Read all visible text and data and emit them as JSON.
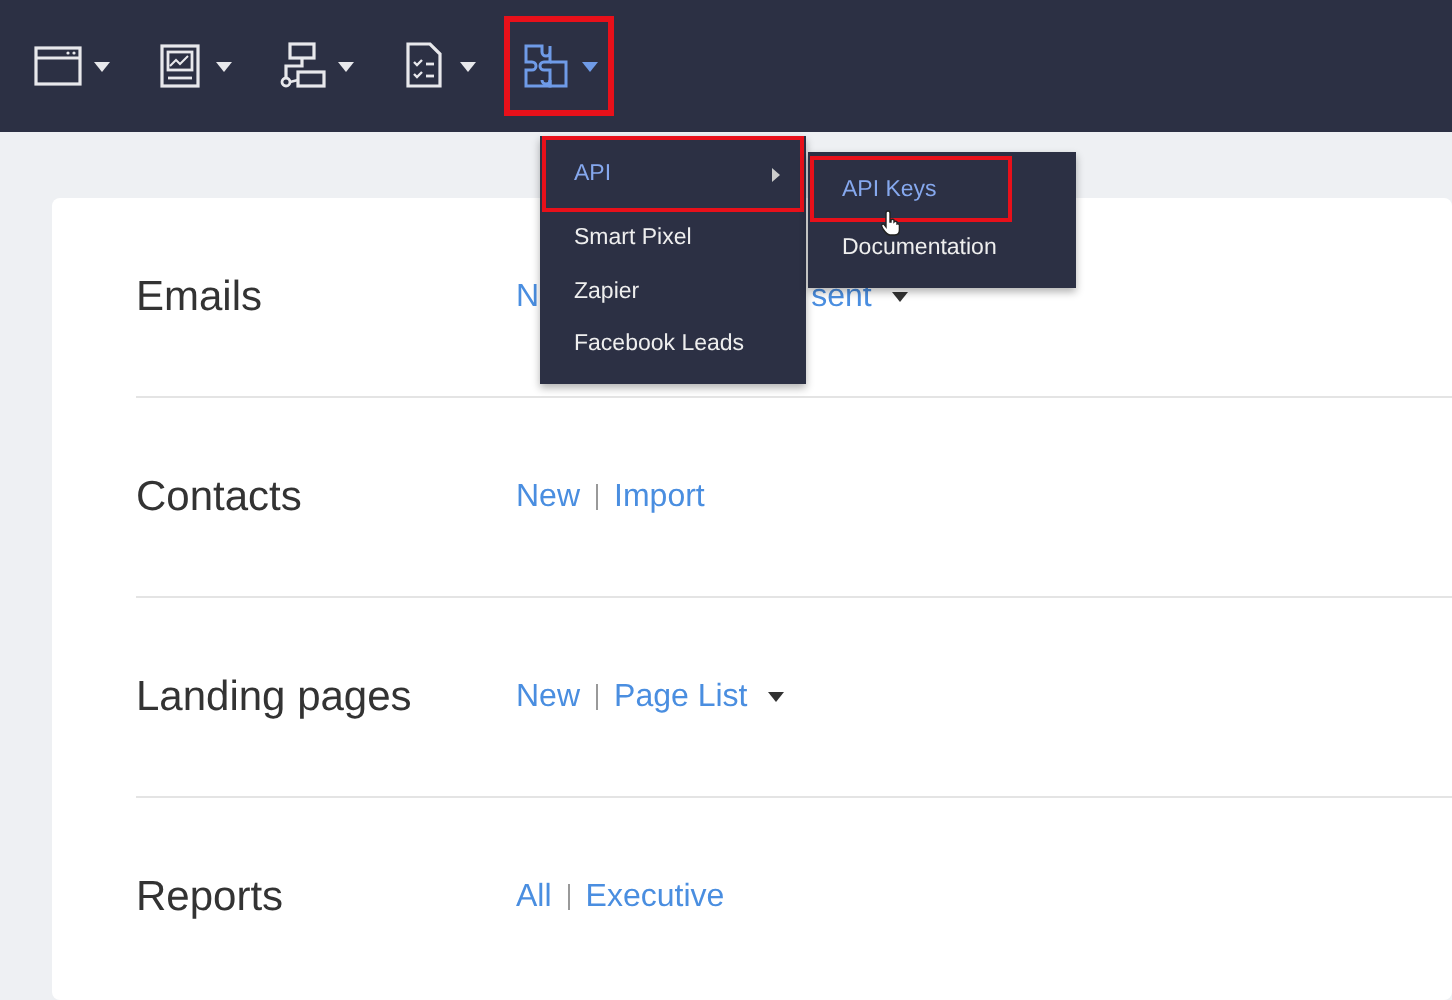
{
  "toolbar": [
    {
      "selected": false
    },
    {
      "selected": false
    },
    {
      "selected": false
    },
    {
      "selected": false
    },
    {
      "selected": true
    }
  ],
  "rows": [
    {
      "title": "Emails",
      "kind": "partial",
      "links": [
        "N",
        "sent"
      ],
      "dropdown": true
    },
    {
      "title": "Contacts",
      "kind": "full",
      "links": [
        "New",
        "Import"
      ],
      "dropdown": false
    },
    {
      "title": "Landing pages",
      "kind": "full",
      "links": [
        "New",
        "Page List"
      ],
      "dropdown": true
    },
    {
      "title": "Reports",
      "kind": "full",
      "links": [
        "All",
        "Executive"
      ],
      "dropdown": false
    }
  ],
  "menu": {
    "items": [
      {
        "label": "API",
        "highlighted": true,
        "submenu": true
      },
      {
        "label": "Smart Pixel",
        "highlighted": false,
        "submenu": false
      },
      {
        "label": "Zapier",
        "highlighted": false,
        "submenu": false
      },
      {
        "label": "Facebook Leads",
        "highlighted": false,
        "submenu": false
      }
    ],
    "submenu": [
      {
        "label": "API Keys",
        "highlighted": true
      },
      {
        "label": "Documentation",
        "highlighted": false
      }
    ]
  }
}
